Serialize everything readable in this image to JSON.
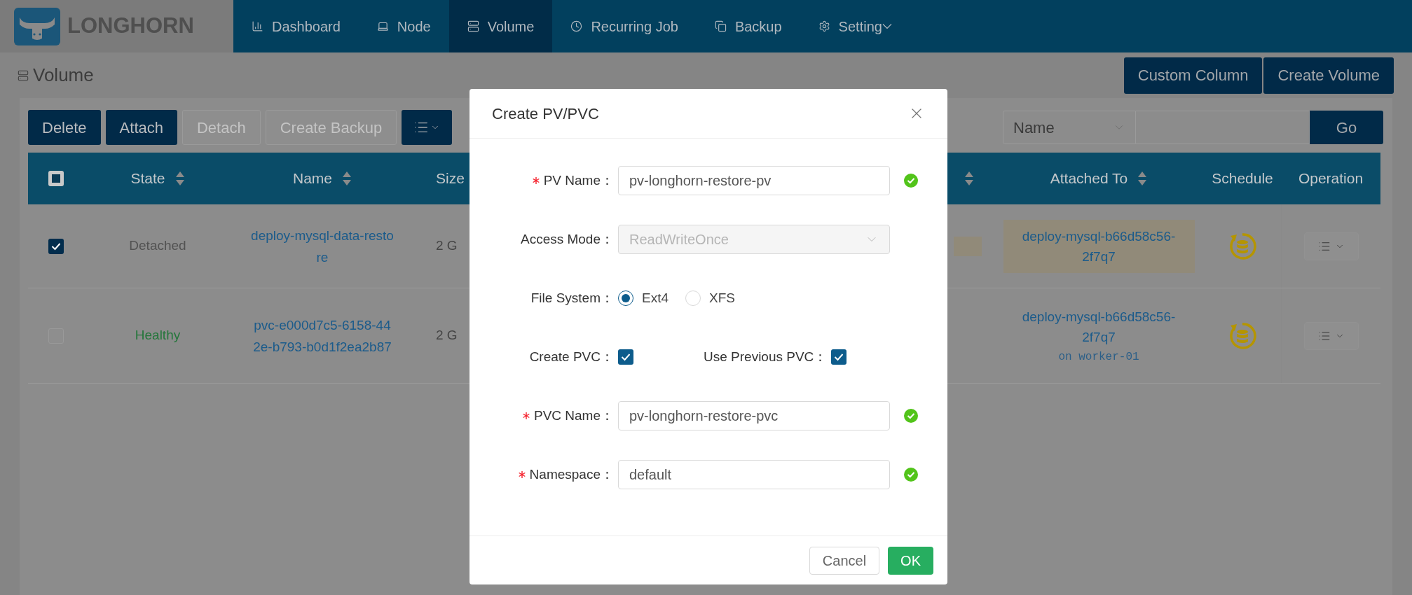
{
  "brand": {
    "name": "LONGHORN"
  },
  "nav": [
    {
      "label": "Dashboard",
      "selected": false,
      "has_dropdown": false
    },
    {
      "label": "Node",
      "selected": false,
      "has_dropdown": false
    },
    {
      "label": "Volume",
      "selected": true,
      "has_dropdown": false
    },
    {
      "label": "Recurring Job",
      "selected": false,
      "has_dropdown": false
    },
    {
      "label": "Backup",
      "selected": false,
      "has_dropdown": false
    },
    {
      "label": "Setting",
      "selected": false,
      "has_dropdown": true
    }
  ],
  "page": {
    "title": "Volume",
    "actions": [
      "Custom Column",
      "Create Volume"
    ]
  },
  "toolbar": {
    "buttons": [
      {
        "kind": "text",
        "label": "Delete",
        "disabled": false
      },
      {
        "kind": "text",
        "label": "Attach",
        "disabled": false
      },
      {
        "kind": "text",
        "label": "Detach",
        "disabled": true
      },
      {
        "kind": "text",
        "label": "Create Backup",
        "disabled": true
      },
      {
        "kind": "menu",
        "disabled": false
      }
    ],
    "filter": {
      "field": "Name",
      "button": "Go"
    }
  },
  "table": {
    "select_all": {
      "indeterminate": true
    },
    "columns": [
      {
        "label": "State",
        "sortable": true
      },
      {
        "label": "Name",
        "sortable": true
      },
      {
        "label": "Size"
      },
      {
        "sortable": true
      },
      {
        "label": "Attached To",
        "sortable": true
      },
      {
        "label": "Schedule"
      },
      {
        "label": "Operation"
      }
    ],
    "rows": [
      {
        "selected": true,
        "state": "Detached",
        "color": "#525252",
        "name": "deploy-mysql-data-restore",
        "size": "2 G",
        "highlighted": true,
        "attached_to": "deploy-mysql-b66d58c56-2f7q7"
      },
      {
        "selected": false,
        "state": "Healthy",
        "color": "#23763a",
        "name": "pvc-e000d7c5-6158-442e-b793-b0d1f2ea2b87",
        "size": "2 G",
        "attached_to": "deploy-mysql-b66d58c56-2f7q7",
        "node": "on worker-01"
      }
    ]
  },
  "dialog": {
    "title": "Create PV/PVC",
    "fields": [
      {
        "kind": "input",
        "label": "PV Name：",
        "required": true,
        "value": "pv-longhorn-restore-pv",
        "valid": true
      },
      {
        "kind": "select",
        "label": "Access Mode：",
        "value": "ReadWriteOnce",
        "disabled": true
      },
      {
        "kind": "radio",
        "label": "File System：",
        "options": [
          {
            "label": "Ext4",
            "selected": true
          },
          {
            "label": "XFS",
            "selected": false
          }
        ]
      },
      {
        "kind": "checkboxes",
        "items": [
          {
            "label": "Create PVC：",
            "checked": true
          },
          {
            "label": "Use Previous PVC：",
            "checked": true
          }
        ]
      },
      {
        "kind": "input",
        "label": "PVC Name：",
        "required": true,
        "value": "pv-longhorn-restore-pvc",
        "valid": true
      },
      {
        "kind": "input",
        "label": "Namespace：",
        "required": true,
        "value": "default",
        "valid": true
      }
    ],
    "buttons": [
      {
        "kind": "default",
        "label": "Cancel"
      },
      {
        "kind": "primary",
        "label": "OK"
      }
    ]
  }
}
